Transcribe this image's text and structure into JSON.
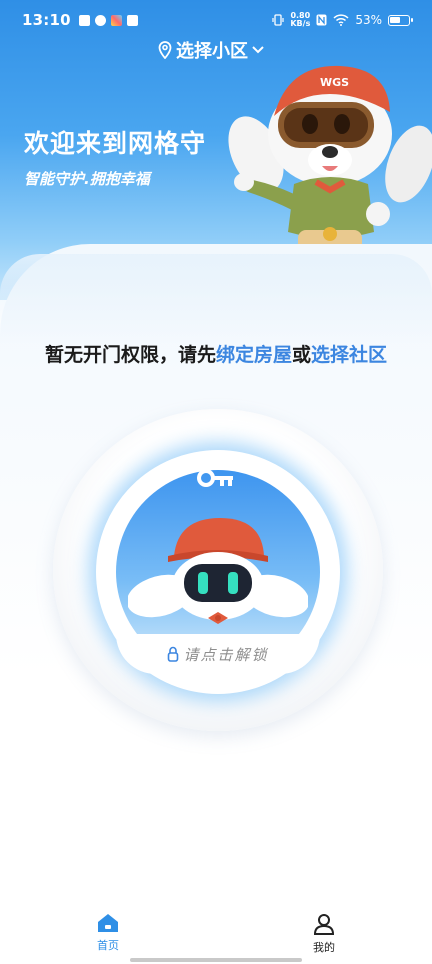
{
  "status_bar": {
    "time": "13:10",
    "net_speed_value": "0.80",
    "net_speed_unit": "KB/s",
    "battery": "53%"
  },
  "header": {
    "community_selector": "选择小区",
    "welcome_title": "欢迎来到网格守",
    "welcome_subtitle": "智能守护.拥抱幸福",
    "mascot_hat_text": "WGS"
  },
  "notice": {
    "prefix": "暂无开门权限，请先",
    "bind_house_link": "绑定房屋",
    "or": "或",
    "select_community_link": "选择社区"
  },
  "unlock": {
    "label": "请点击解锁"
  },
  "tabbar": {
    "home_label": "首页",
    "mine_label": "我的"
  },
  "colors": {
    "brand_blue": "#2f8fe6",
    "link_blue": "#3c86e0"
  },
  "icons": {
    "location": "location-pin-icon",
    "chevron": "chevron-down-icon",
    "key": "key-icon",
    "lock": "lock-icon",
    "home": "home-icon",
    "user": "user-icon"
  }
}
